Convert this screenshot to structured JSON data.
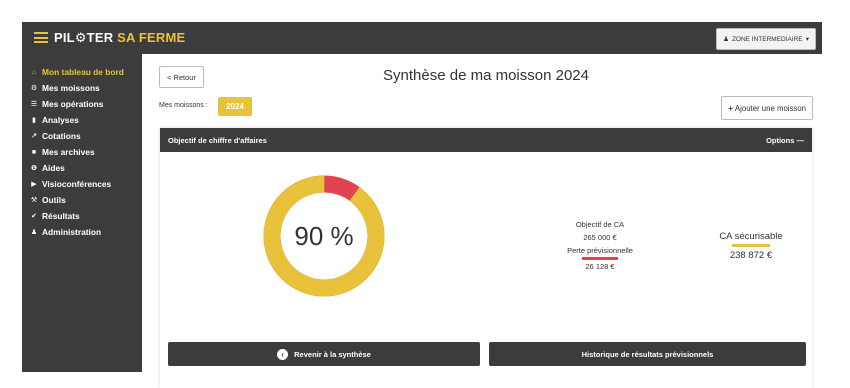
{
  "brand": {
    "part1": "PIL⚙TER",
    "part2": "SA FERME"
  },
  "topbar": {
    "zone_label": "ZONE INTERMEDIAIRE"
  },
  "colors": {
    "accent": "#e8c23a",
    "dark": "#3c3c3c",
    "loss": "#e04452"
  },
  "sidebar": {
    "items": [
      {
        "label": "Mon tableau de bord",
        "icon": "home-icon",
        "active": true
      },
      {
        "label": "Mes moissons",
        "icon": "tractor-icon"
      },
      {
        "label": "Mes opérations",
        "icon": "list-icon"
      },
      {
        "label": "Analyses",
        "icon": "bar-chart-icon"
      },
      {
        "label": "Cotations",
        "icon": "line-chart-icon"
      },
      {
        "label": "Mes archives",
        "icon": "archive-icon"
      },
      {
        "label": "Aides",
        "icon": "info-icon"
      },
      {
        "label": "Visioconférences",
        "icon": "video-icon"
      },
      {
        "label": "Outils",
        "icon": "wrench-icon"
      },
      {
        "label": "Résultats",
        "icon": "check-icon"
      },
      {
        "label": "Administration",
        "icon": "user-icon"
      }
    ]
  },
  "header": {
    "back_label": "< Retour",
    "title": "Synthèse de ma moisson 2024"
  },
  "moissons": {
    "label": "Mes moissons :",
    "year": "2024",
    "add_label": "Ajouter une moisson"
  },
  "panel": {
    "title": "Objectif de chiffre d'affaires",
    "options_label": "Options",
    "progress_text": "90 %",
    "progress_fraction": 0.9,
    "objective_label": "Objectif de CA",
    "objective_value": "265 000 €",
    "loss_label": "Perte prévisionnelle",
    "loss_value": "26 128 €",
    "secure_label": "CA sécurisable",
    "secure_value": "238 872 €",
    "back_button": "Revenir à la synthèse",
    "history_button": "Historique de résultats prévisionnels"
  }
}
